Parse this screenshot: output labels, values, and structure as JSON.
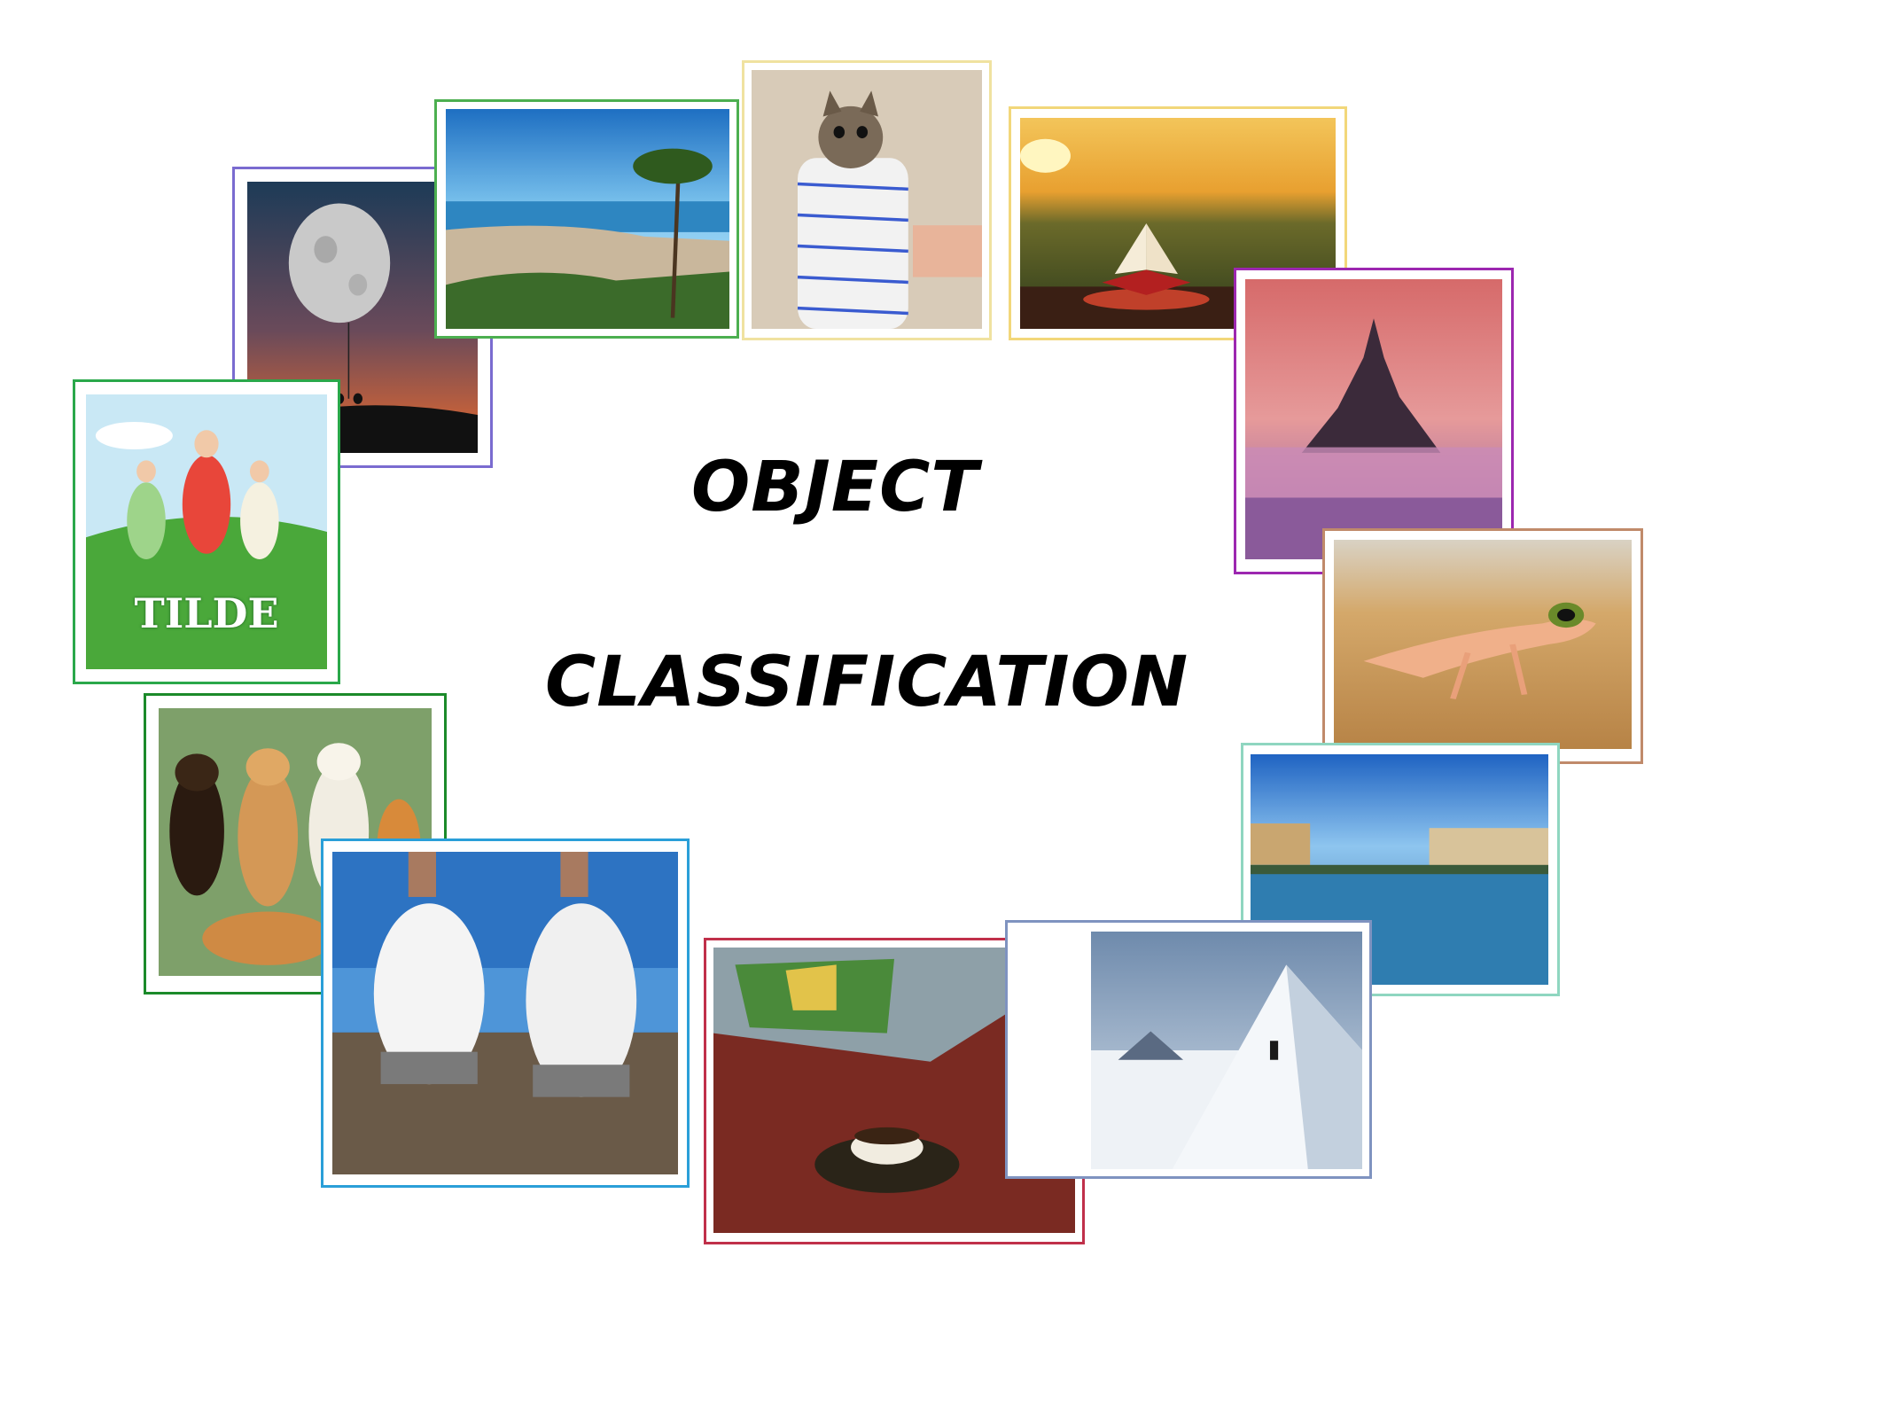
{
  "title": {
    "line1": "OBJECT",
    "line2": "CLASSIFICATION"
  },
  "tiles": [
    {
      "id": "moon-swing",
      "icon": "moon-night-sky-image",
      "border": "#7a6bd0"
    },
    {
      "id": "coastal-city",
      "icon": "coastal-city-pine-image",
      "border": "#4caf50"
    },
    {
      "id": "cat-in-towel",
      "icon": "cat-in-towel-image",
      "border": "#f0e2a0"
    },
    {
      "id": "book-sunset",
      "icon": "open-book-sunset-image",
      "border": "#f2d77a"
    },
    {
      "id": "castle-fog",
      "icon": "castle-in-fog-image",
      "border": "#9c27b0"
    },
    {
      "id": "book-cover",
      "icon": "tilde-book-cover-image",
      "border": "#2aa84a",
      "cover_title": "TILDE"
    },
    {
      "id": "gecko",
      "icon": "gecko-on-sand-image",
      "border": "#c08a6a"
    },
    {
      "id": "dogs",
      "icon": "shiba-dogs-image",
      "border": "#1b8a2a"
    },
    {
      "id": "river-city",
      "icon": "river-city-image",
      "border": "#8fd6c0"
    },
    {
      "id": "sneakers",
      "icon": "white-sneakers-image",
      "border": "#2a9fd8"
    },
    {
      "id": "coffee",
      "icon": "turkish-coffee-image",
      "border": "#c0304a"
    },
    {
      "id": "mountain",
      "icon": "snowy-mountain-image",
      "border": "#7f93c0"
    }
  ]
}
